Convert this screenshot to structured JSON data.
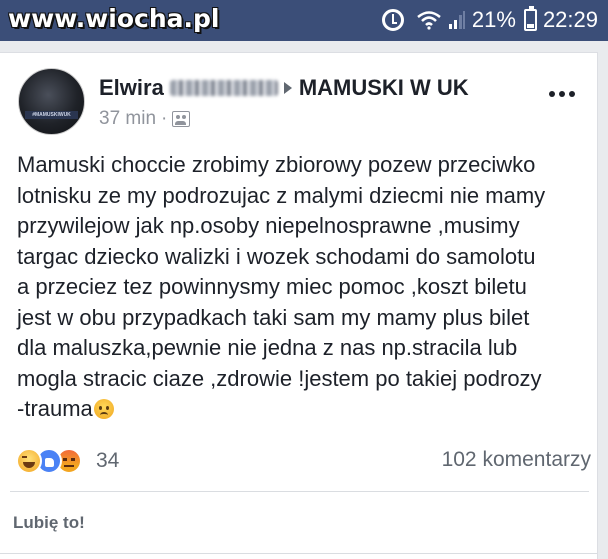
{
  "statusbar": {
    "watermark": "www.wiocha.pl",
    "battery_percent": "21%",
    "time": "22:29",
    "icons": [
      "alarm-icon",
      "wifi-icon",
      "signal-icon",
      "battery-icon"
    ]
  },
  "post": {
    "author": "Elwira",
    "group": "MAMUSKI W UK",
    "time_ago": "37 min",
    "meta_separator": "·",
    "avatar_text": "#MAMUSKIWUK",
    "text_lines": [
      "Mamuski choccie zrobimy zbiorowy pozew przeciwko",
      "lotnisku ze my podrozujac z malymi dziecmi nie mamy",
      "przywilejow jak np.osoby niepelnosprawne ,musimy",
      "targac dziecko walizki i wozek schodami do samolotu",
      "a przeciez tez powinnysmy miec pomoc ,koszt biletu",
      "jest w obu przypadkach taki sam my mamy plus bilet",
      "dla maluszka,pewnie nie jedna z nas np.stracila lub",
      "mogla stracic ciaze ,zdrowie !jestem po takiej podrozy",
      "-trauma"
    ],
    "reactions": [
      "haha-icon",
      "like-icon",
      "angry-icon"
    ],
    "reaction_count": "34",
    "comments": "102 komentarzy",
    "like_label": "Lubię to!"
  },
  "colors": {
    "statusbar_bg": "#3b4e78",
    "text": "#1d2129",
    "muted": "#90949c"
  }
}
